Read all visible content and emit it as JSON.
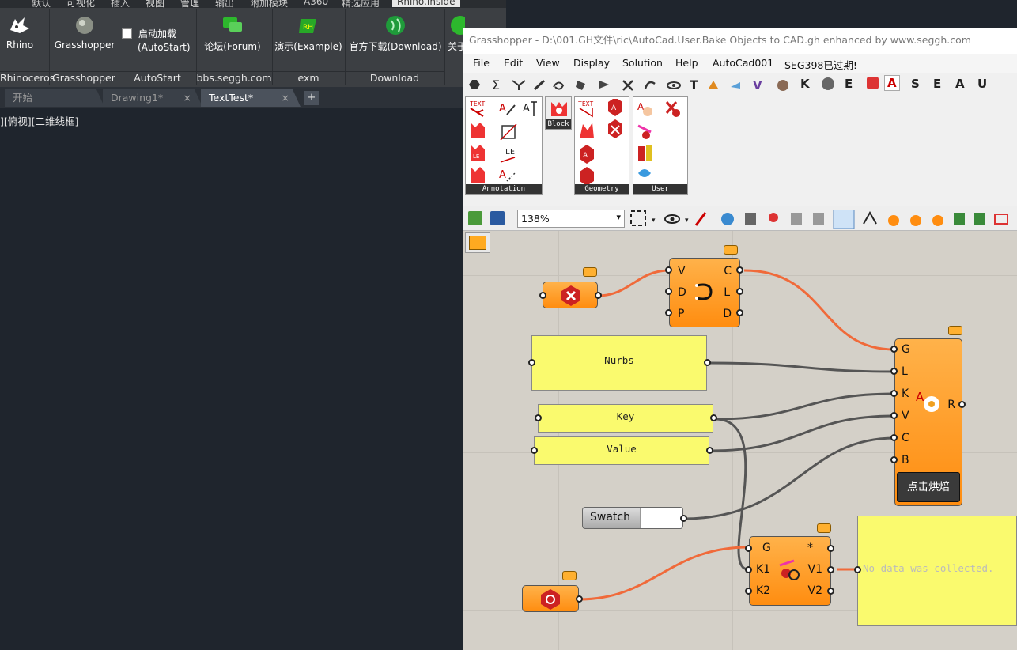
{
  "ribbon": {
    "tabs": [
      "默认",
      "可视化",
      "插入",
      "视图",
      "管理",
      "输出",
      "附加模块",
      "A360",
      "精选应用",
      "Rhino.Inside"
    ],
    "buttons": {
      "rhino": "Rhino",
      "grasshopper": "Grasshopper",
      "autostart_line1": "启动加载",
      "autostart_line2": "(AutoStart)",
      "forum": "论坛(Forum)",
      "example": "演示(Example)",
      "download": "官方下载(Download)",
      "about": "关于"
    },
    "groups": [
      "Rhinoceros",
      "Grasshopper",
      "AutoStart",
      "bbs.seggh.com",
      "exm",
      "Download"
    ]
  },
  "doc_tabs": [
    {
      "label": "开始"
    },
    {
      "label": "Drawing1*",
      "close": "×"
    },
    {
      "label": "TextTest*",
      "close": "×"
    }
  ],
  "new_tab": "+",
  "viewport_label": "][俯视][二维线框]",
  "gh": {
    "title": "Grasshopper - D:\\001.GH文件\\ric\\AutoCad.User.Bake Objects to CAD.gh  enhanced by www.seggh.com",
    "menu": [
      "File",
      "Edit",
      "View",
      "Display",
      "Solution",
      "Help",
      "AutoCad001",
      "SEG398已过期!"
    ],
    "tab_letters": [
      "K",
      "E",
      "A",
      "S",
      "E",
      "A",
      "U"
    ],
    "panels": [
      "Annotation",
      "Geometry",
      "User"
    ],
    "block_label": "Block",
    "zoom": "138%"
  },
  "canvas": {
    "panel_nurbs": "Nurbs",
    "panel_key": "Key",
    "panel_value": "Value",
    "swatch_label": "Swatch",
    "bake_button": "点击烘焙",
    "no_data": "No data was collected.",
    "comp1_inputs": [
      "V",
      "D",
      "P"
    ],
    "comp1_outputs": [
      "C",
      "L",
      "D"
    ],
    "comp2_inputs": [
      "G",
      "L",
      "K",
      "V",
      "C",
      "B"
    ],
    "comp2_output": "R",
    "comp3_inputs": [
      "G",
      "K1",
      "K2"
    ],
    "comp3_outputs": [
      "*",
      "V1",
      "V2"
    ]
  },
  "colors": {
    "wire_orange": "#f06a3a",
    "wire_dark": "#555555",
    "component": "#ff9a20",
    "panel": "#fafa6e"
  }
}
